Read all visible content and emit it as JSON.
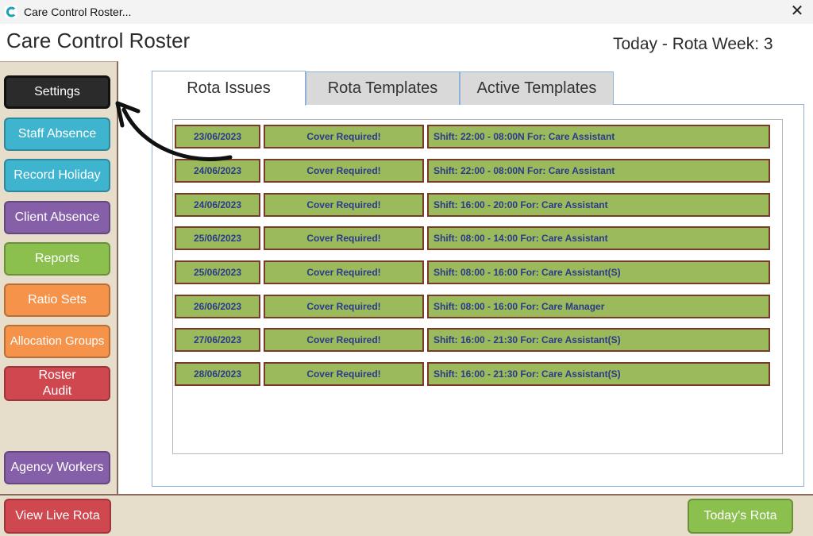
{
  "window": {
    "title": "Care Control Roster..."
  },
  "header": {
    "app_title": "Care Control Roster",
    "week_label": "Today - Rota Week: 3"
  },
  "sidebar": {
    "items": [
      {
        "label": "Settings"
      },
      {
        "label": "Staff Absence"
      },
      {
        "label": "Record Holiday"
      },
      {
        "label": "Client Absence"
      },
      {
        "label": "Reports"
      },
      {
        "label": "Ratio Sets"
      },
      {
        "label": "Allocation Groups"
      },
      {
        "label": "Roster\nAudit"
      },
      {
        "label": "Agency Workers"
      }
    ]
  },
  "tabs": [
    {
      "label": "Rota Issues",
      "active": true
    },
    {
      "label": "Rota Templates",
      "active": false
    },
    {
      "label": "Active Templates",
      "active": false
    }
  ],
  "issues": [
    {
      "date": "23/06/2023",
      "status": "Cover Required!",
      "detail": "Shift: 22:00 - 08:00N For: Care Assistant"
    },
    {
      "date": "24/06/2023",
      "status": "Cover Required!",
      "detail": "Shift: 22:00 - 08:00N For: Care Assistant"
    },
    {
      "date": "24/06/2023",
      "status": "Cover Required!",
      "detail": "Shift: 16:00 - 20:00 For: Care Assistant"
    },
    {
      "date": "25/06/2023",
      "status": "Cover Required!",
      "detail": "Shift: 08:00 - 14:00 For: Care Assistant"
    },
    {
      "date": "25/06/2023",
      "status": "Cover Required!",
      "detail": "Shift: 08:00 - 16:00 For: Care Assistant(S)"
    },
    {
      "date": "26/06/2023",
      "status": "Cover Required!",
      "detail": "Shift: 08:00 - 16:00 For: Care Manager"
    },
    {
      "date": "27/06/2023",
      "status": "Cover Required!",
      "detail": "Shift: 16:00 - 21:30 For: Care Assistant(S)"
    },
    {
      "date": "28/06/2023",
      "status": "Cover Required!",
      "detail": "Shift: 16:00 - 21:30 For: Care Assistant(S)"
    }
  ],
  "footer": {
    "view_live_rota": "View Live Rota",
    "todays_rota": "Today's Rota"
  },
  "colors": {
    "issue_cell": "#9aba5c",
    "issue_border": "#7a3a2a",
    "issue_text": "#2b3a8a",
    "sidebar_bg": "#e6ddca"
  },
  "icons": {
    "app": "care-control-logo-icon",
    "close": "close-icon",
    "annotation": "pointer-arrow-icon"
  }
}
